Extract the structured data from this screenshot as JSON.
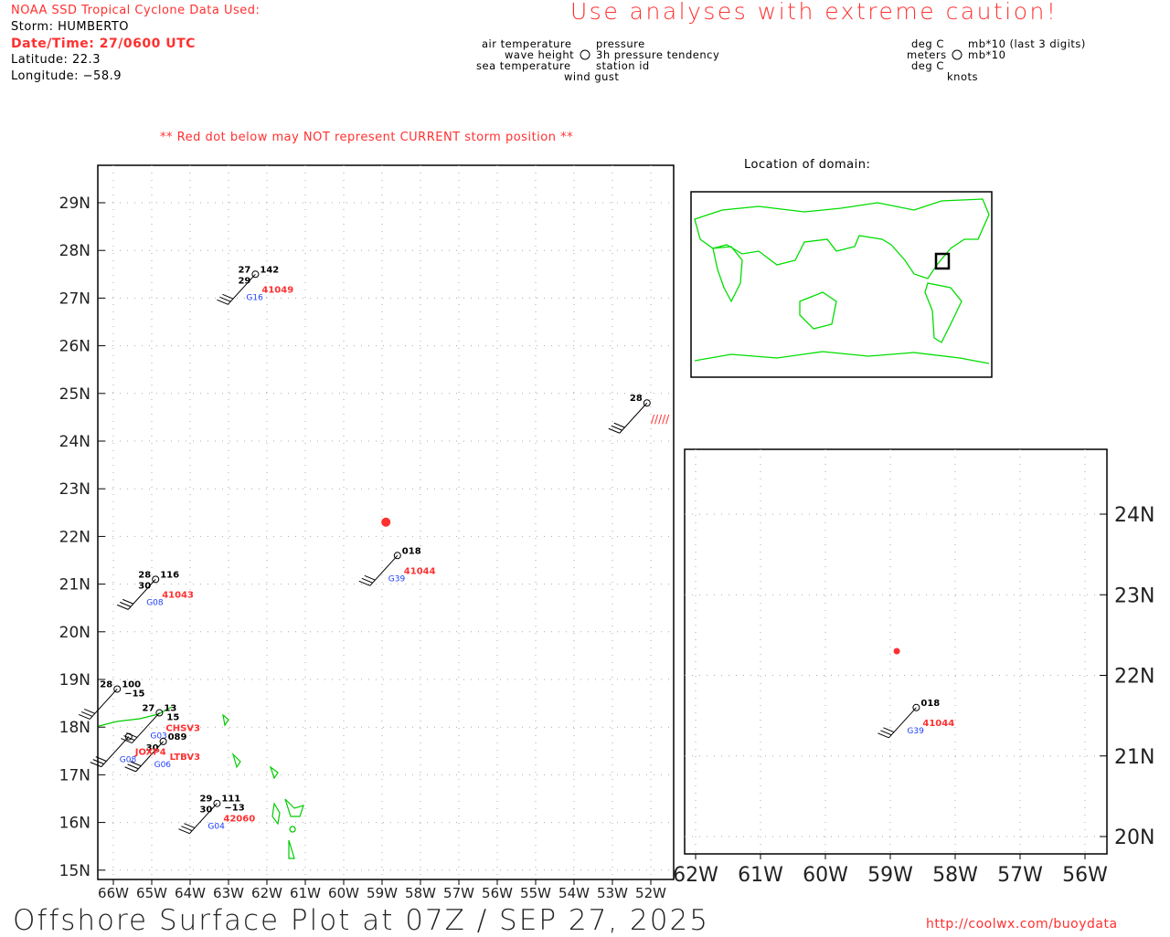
{
  "header": {
    "source": "NOAA SSD Tropical Cyclone Data Used:",
    "storm": "Storm: HUMBERTO",
    "datetime": "Date/Time: 27/0600 UTC",
    "latitude": "Latitude: 22.3",
    "longitude": "Longitude: −58.9",
    "caution": "Use analyses with extreme caution!",
    "red_dot_note": "** Red dot below may NOT represent CURRENT storm position **"
  },
  "legend": {
    "left": [
      "air temperature",
      "wave height",
      "sea temperature"
    ],
    "right": [
      "pressure",
      "3h pressure tendency",
      "station id"
    ],
    "bottom": "wind gust",
    "units_left": [
      "deg C",
      "meters",
      "deg C"
    ],
    "units_right": [
      "mb*10 (last 3 digits)",
      "mb*10"
    ],
    "units_bottom": "knots"
  },
  "domain_label": "Location of domain:",
  "footer": {
    "title": "Offshore Surface Plot at 07Z / SEP 27, 2025",
    "url": "http://coolwx.com/buoydata"
  },
  "colors": {
    "red": "#ff3030",
    "blue": "#2040ff",
    "land": "#00cc00"
  },
  "main_map": {
    "lat_ticks": [
      "29N",
      "28N",
      "27N",
      "26N",
      "25N",
      "24N",
      "23N",
      "22N",
      "21N",
      "20N",
      "19N",
      "18N",
      "17N",
      "16N",
      "15N"
    ],
    "lon_ticks": [
      "66W",
      "65W",
      "64W",
      "63W",
      "62W",
      "61W",
      "60W",
      "59W",
      "58W",
      "57W",
      "56W",
      "55W",
      "54W",
      "53W",
      "52W"
    ],
    "storm": {
      "lat": 22.3,
      "lon": -58.9
    },
    "stations": [
      {
        "id": "41049",
        "lat": 27.5,
        "lon": -62.3,
        "air": "27",
        "sea": "29",
        "pres": "142",
        "tend": "",
        "gid": "G16"
      },
      {
        "id": "41044",
        "lat": 21.6,
        "lon": -58.6,
        "air": "",
        "sea": "",
        "pres": "018",
        "tend": "",
        "gid": "G39"
      },
      {
        "id": "41043",
        "lat": 21.1,
        "lon": -64.9,
        "air": "28",
        "sea": "30",
        "pres": "116",
        "tend": "",
        "gid": "G08"
      },
      {
        "id": "42060",
        "lat": 16.4,
        "lon": -63.3,
        "air": "29",
        "sea": "30",
        "pres": "111",
        "tend": "−13",
        "gid": "G04"
      },
      {
        "id": "",
        "lat": 24.8,
        "lon": -52.1,
        "air": "28",
        "sea": "",
        "pres": "",
        "tend": "",
        "gid": ""
      },
      {
        "id": "",
        "lat": 18.8,
        "lon": -65.9,
        "air": "28",
        "sea": "",
        "pres": "100",
        "tend": "−15",
        "gid": ""
      },
      {
        "id": "CHSV3",
        "lat": 18.3,
        "lon": -64.8,
        "air": "27",
        "sea": "",
        "pres": "13",
        "tend": "15",
        "gid": "G03"
      },
      {
        "id": "LTBV3",
        "lat": 17.7,
        "lon": -64.7,
        "air": "",
        "sea": "30",
        "pres": "089",
        "tend": "",
        "gid": "G06"
      },
      {
        "id": "JOXP4",
        "lat": 17.8,
        "lon": -65.6,
        "air": "",
        "sea": "",
        "pres": "",
        "tend": "",
        "gid": "G08"
      }
    ]
  },
  "inset_map": {
    "lat_ticks": [
      "24N",
      "23N",
      "22N",
      "21N",
      "20N"
    ],
    "lon_ticks": [
      "62W",
      "61W",
      "60W",
      "59W",
      "58W",
      "57W",
      "56W"
    ],
    "storm": {
      "lat": 22.3,
      "lon": -58.9
    },
    "station": {
      "id": "41044",
      "lat": 21.6,
      "lon": -58.6,
      "pres": "018",
      "gid": "G39"
    }
  }
}
